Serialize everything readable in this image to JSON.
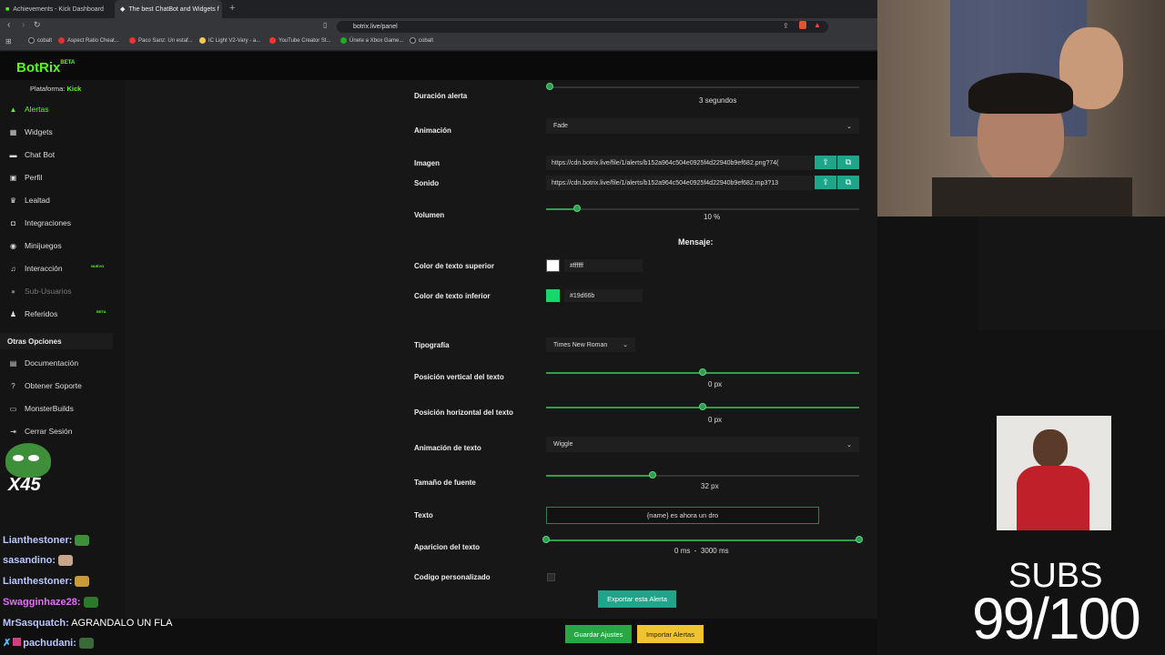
{
  "browser": {
    "tabs": [
      "Achievements - Kick Dashboard",
      "The best ChatBot and Widgets f"
    ],
    "url": "botrix.live/panel",
    "bookmarks": [
      "cobalt",
      "Aspect Ratio Cheat...",
      "Paco Sanz: Un estaf...",
      "IC Light V2-Vary - a...",
      "YouTube Creator St...",
      "Únete a Xbox Game...",
      "cobalt"
    ]
  },
  "sidebar": {
    "logo": "BotRix",
    "logo_badge": "BETA",
    "platform_label": "Plataforma:",
    "platform_value": "Kick",
    "items": [
      {
        "label": "Alertas",
        "icon": "alert-icon"
      },
      {
        "label": "Widgets",
        "icon": "grid-icon"
      },
      {
        "label": "Chat Bot",
        "icon": "chat-icon"
      },
      {
        "label": "Perfil",
        "icon": "profile-icon"
      },
      {
        "label": "Lealtad",
        "icon": "trophy-icon"
      },
      {
        "label": "Integraciones",
        "icon": "integrations-icon"
      },
      {
        "label": "Minijuegos",
        "icon": "gamepad-icon"
      },
      {
        "label": "Interacción",
        "icon": "music-icon",
        "tag": "NUEVO"
      },
      {
        "label": "Sub-Usuarios",
        "icon": "users-icon"
      },
      {
        "label": "Referidos",
        "icon": "referral-icon",
        "tag": "BETA"
      }
    ],
    "other_title": "Otras Opciones",
    "other_items": [
      {
        "label": "Documentación",
        "icon": "doc-icon"
      },
      {
        "label": "Obtener Soporte",
        "icon": "help-icon"
      },
      {
        "label": "MonsterBuilds",
        "icon": "monitor-icon"
      },
      {
        "label": "Cerrar Sesión",
        "icon": "logout-icon"
      }
    ]
  },
  "form": {
    "duracion": {
      "label": "Duración alerta",
      "value": "3",
      "unit": "segundos"
    },
    "animacion": {
      "label": "Animación",
      "value": "Fade"
    },
    "imagen": {
      "label": "Imagen",
      "value": "https://cdn.botrix.live/file/1/alerts/b152a964c504e0925f4d22940b9ef682.png?74("
    },
    "sonido": {
      "label": "Sonido",
      "value": "https://cdn.botrix.live/file/1/alerts/b152a964c504e0925f4d22940b9ef682.mp3?13"
    },
    "volumen": {
      "label": "Volumen",
      "value": "10",
      "unit": "%",
      "fraction": 0.1
    },
    "mensaje_title": "Mensaje:",
    "color_superior": {
      "label": "Color de texto superior",
      "value": "#ffffff",
      "color": "#ffffff"
    },
    "color_inferior": {
      "label": "Color de texto inferior",
      "value": "#19d66b",
      "color": "#19d66b"
    },
    "tipografia": {
      "label": "Tipografía",
      "value": "Times New Roman"
    },
    "pos_vertical": {
      "label": "Posición vertical del texto",
      "value": "0",
      "unit": "px",
      "fraction": 0.5
    },
    "pos_horizontal": {
      "label": "Posición horizontal del texto",
      "value": "0",
      "unit": "px",
      "fraction": 0.5
    },
    "animacion_texto": {
      "label": "Animación de texto",
      "value": "Wiggle"
    },
    "tamano": {
      "label": "Tamaño de fuente",
      "value": "32",
      "unit": "px",
      "fraction": 0.34
    },
    "texto": {
      "label": "Texto",
      "value": "{name} es ahora un dro"
    },
    "aparicion": {
      "label": "Aparicion del texto",
      "min": "0",
      "max": "3000",
      "unit": "ms"
    },
    "codigo": {
      "label": "Codigo personalizado"
    }
  },
  "buttons": {
    "exportar": "Exportar esta Alerta",
    "guardar": "Guardar Ajustes",
    "importar": "Importar Alertas"
  },
  "chat": [
    {
      "user": "Lianthestoner:",
      "color": "#b9c7ff"
    },
    {
      "user": "sasandino:",
      "color": "#b9c7ff"
    },
    {
      "user": "Lianthestoner:",
      "color": "#b9c7ff"
    },
    {
      "user": "Swagginhaze28:",
      "color": "#e86bff"
    },
    {
      "user": "MrSasquatch:",
      "msg": "AGRANDALO UN FLA",
      "color": "#b9c7ff"
    },
    {
      "user": "pachudani:",
      "color": "#b9c7ff"
    }
  ],
  "overlay": {
    "emote_badge": "X45",
    "subs_label": "SUBS",
    "subs_count": "99/100"
  }
}
